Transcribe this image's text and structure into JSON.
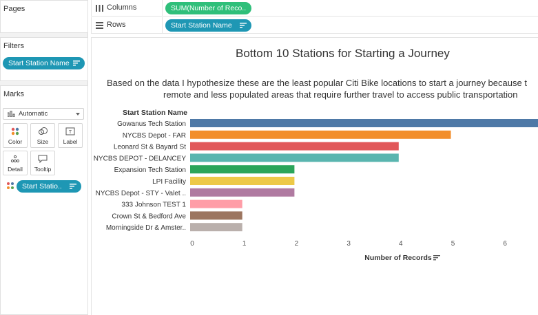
{
  "colors": {
    "pill_blue": "#1e97b4",
    "pill_green": "#2fbf7a"
  },
  "pages": {
    "title": "Pages"
  },
  "filters": {
    "title": "Filters",
    "pill": "Start Station Name"
  },
  "marks": {
    "title": "Marks",
    "mark_type": "Automatic",
    "buttons": [
      {
        "label": "Color",
        "icon": "color-dots-icon"
      },
      {
        "label": "Size",
        "icon": "size-icon"
      },
      {
        "label": "Label",
        "icon": "label-icon"
      },
      {
        "label": "Detail",
        "icon": "detail-icon"
      },
      {
        "label": "Tooltip",
        "icon": "tooltip-icon"
      }
    ],
    "color_pill": "Start Statio.."
  },
  "shelves": {
    "columns": {
      "label": "Columns",
      "pill": "SUM(Number of Reco.."
    },
    "rows": {
      "label": "Rows",
      "pill": "Start Station Name"
    }
  },
  "view": {
    "title": "Bottom 10 Stations for Starting a Journey",
    "caption_line1": "Based on the data I hypothesize these are the least popular Citi Bike locations to start a journey because t",
    "caption_line2": "remote and less populated areas that require further travel to access public transportation"
  },
  "chart_data": {
    "type": "bar",
    "orientation": "horizontal",
    "row_header": "Start Station Name",
    "xlabel": "Number of Records",
    "xlim": [
      0,
      6.6
    ],
    "x_ticks": [
      "0",
      "1",
      "2",
      "3",
      "4",
      "5",
      "6"
    ],
    "categories": [
      "Gowanus Tech Station",
      "NYCBS Depot - FAR",
      "Leonard St & Bayard St",
      "NYCBS DEPOT - DELANCEY",
      "Expansion Tech Station",
      "LPI Facility",
      "NYCBS Depot - STY - Valet ..",
      "333 Johnson TEST 1",
      "Crown St & Bedford Ave",
      "Morningside Dr & Amster.."
    ],
    "values": [
      7,
      5,
      4,
      4,
      2,
      2,
      2,
      1,
      1,
      1
    ],
    "colors": [
      "#4e79a7",
      "#f28e2b",
      "#e15759",
      "#59b5af",
      "#2ba55a",
      "#edc948",
      "#b07aa1",
      "#ff9da7",
      "#9c755f",
      "#bab0ac"
    ],
    "grid": false,
    "legend": "none"
  }
}
